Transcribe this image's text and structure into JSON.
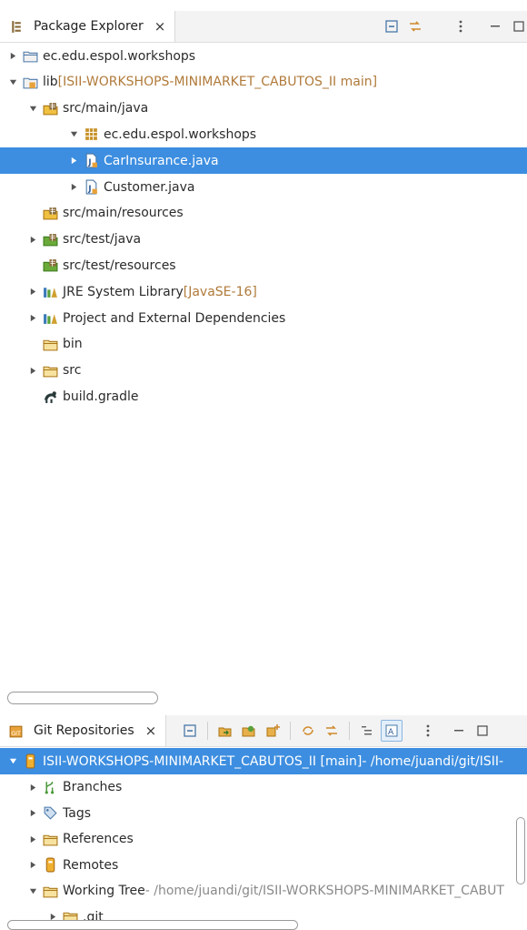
{
  "package_explorer": {
    "tab_title": "Package Explorer",
    "close_glyph": "×",
    "toolbar_icons": [
      "collapse-all-icon",
      "link-with-editor-icon",
      "view-menu-icon",
      "minimize-icon",
      "maximize-icon"
    ],
    "tree": [
      {
        "label": "ec.edu.espol.workshops",
        "deco": "",
        "expander": "collapsed",
        "icon": "project-folder-icon"
      },
      {
        "label": "lib",
        "deco": "[ISII-WORKSHOPS-MINIMARKET_CABUTOS_II main]",
        "expander": "expanded",
        "icon": "git-project-icon"
      },
      {
        "label": "src/main/java",
        "deco": "",
        "expander": "expanded",
        "icon": "source-folder-icon"
      },
      {
        "label": "ec.edu.espol.workshops",
        "deco": "",
        "expander": "expanded",
        "icon": "package-icon"
      },
      {
        "label": "CarInsurance.java",
        "deco": "",
        "expander": "collapsed",
        "icon": "java-file-icon",
        "selected": true
      },
      {
        "label": "Customer.java",
        "deco": "",
        "expander": "collapsed",
        "icon": "java-file-icon"
      },
      {
        "label": "src/main/resources",
        "deco": "",
        "expander": "none",
        "icon": "source-folder-icon"
      },
      {
        "label": "src/test/java",
        "deco": "",
        "expander": "collapsed",
        "icon": "test-source-folder-icon"
      },
      {
        "label": "src/test/resources",
        "deco": "",
        "expander": "none",
        "icon": "test-source-folder-icon"
      },
      {
        "label": "JRE System Library",
        "deco": "[JavaSE-16]",
        "expander": "collapsed",
        "icon": "library-icon"
      },
      {
        "label": "Project and External Dependencies",
        "deco": "",
        "expander": "collapsed",
        "icon": "library-icon"
      },
      {
        "label": "bin",
        "deco": "",
        "expander": "none",
        "icon": "folder-icon"
      },
      {
        "label": "src",
        "deco": "",
        "expander": "collapsed",
        "icon": "folder-icon"
      },
      {
        "label": "build.gradle",
        "deco": "",
        "expander": "none",
        "icon": "gradle-file-icon"
      }
    ]
  },
  "git_repositories": {
    "tab_title": "Git Repositories",
    "close_glyph": "×",
    "toolbar_icons": [
      "collapse-all-icon",
      "add-repository-icon",
      "clone-repository-icon",
      "create-repository-icon",
      "refresh-icon",
      "link-with-selection-icon",
      "toggle-layout-icon",
      "show-details-icon",
      "view-menu-icon",
      "minimize-icon",
      "maximize-icon"
    ],
    "tree": [
      {
        "label": "ISII-WORKSHOPS-MINIMARKET_CABUTOS_II [main]",
        "deco": " - /home/juandi/git/ISII-",
        "expander": "expanded",
        "icon": "git-repository-icon",
        "selected": true
      },
      {
        "label": "Branches",
        "deco": "",
        "expander": "collapsed",
        "icon": "branches-icon"
      },
      {
        "label": "Tags",
        "deco": "",
        "expander": "collapsed",
        "icon": "tags-icon"
      },
      {
        "label": "References",
        "deco": "",
        "expander": "collapsed",
        "icon": "folder-icon"
      },
      {
        "label": "Remotes",
        "deco": "",
        "expander": "collapsed",
        "icon": "remotes-icon"
      },
      {
        "label": "Working Tree",
        "deco": " - /home/juandi/git/ISII-WORKSHOPS-MINIMARKET_CABUT",
        "expander": "expanded",
        "icon": "folder-icon"
      },
      {
        "label": ".git",
        "deco": "",
        "expander": "collapsed",
        "icon": "folder-icon"
      }
    ]
  },
  "colors": {
    "selection": "#3d8ee0",
    "decoration": "#b07a3a",
    "git_decoration": "#8a8a8a"
  }
}
